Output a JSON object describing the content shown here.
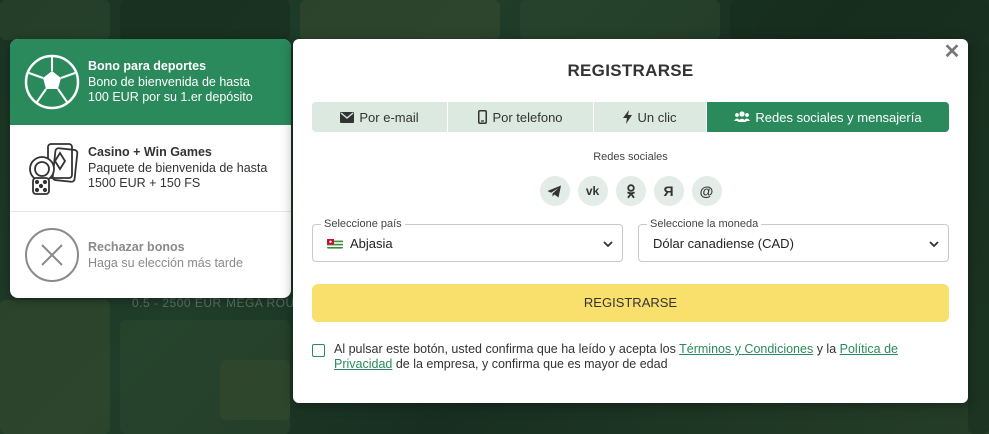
{
  "background": {
    "lobby_texts": [
      "0.5 - 2500 EUR",
      "MEGA ROULE"
    ]
  },
  "bonus_panel": {
    "sports": {
      "title": "Bono para deportes",
      "line1": "Bono de bienvenida de hasta",
      "line2": "100 EUR por su 1.er depósito",
      "icon": "soccer-ball-icon"
    },
    "casino": {
      "title": "Casino + Win Games",
      "line1": "Paquete de bienvenida de hasta",
      "line2": "1500 EUR + 150 FS",
      "icon": "casino-chips-cards-icon"
    },
    "reject": {
      "title": "Rechazar bonos",
      "line1": "Haga su elección más tarde",
      "icon": "close-circle-icon"
    }
  },
  "modal": {
    "close_glyph": "✕",
    "title": "REGISTRARSE",
    "tabs": [
      {
        "label": "Por e-mail",
        "icon": "envelope-icon"
      },
      {
        "label": "Por telefono",
        "icon": "phone-icon"
      },
      {
        "label": "Un clic",
        "icon": "lightning-icon"
      },
      {
        "label": "Redes sociales y mensajería",
        "icon": "users-icon",
        "active": true
      }
    ],
    "social_label": "Redes sociales",
    "social": [
      {
        "name": "telegram",
        "icon": "telegram-icon"
      },
      {
        "name": "vk",
        "glyph": "vk",
        "icon": "vk-icon"
      },
      {
        "name": "odnoklassniki",
        "icon": "odnoklassniki-icon"
      },
      {
        "name": "yandex",
        "glyph": "Я",
        "icon": "yandex-icon"
      },
      {
        "name": "mail",
        "glyph": "@",
        "icon": "mail-at-icon"
      }
    ],
    "country": {
      "label": "Seleccione país",
      "value": "Abjasia"
    },
    "currency": {
      "label": "Seleccione la moneda",
      "value": "Dólar canadiense (CAD)"
    },
    "submit_label": "REGISTRARSE",
    "consent": {
      "part1": "Al pulsar este botón, usted confirma que ha leído y acepta los ",
      "terms_link": "Términos y Condiciones",
      "part2": " y la ",
      "privacy_link": "Política de Privacidad",
      "part3": " de la empresa, y confirma que es mayor de edad"
    }
  },
  "colors": {
    "accent_green": "#2a8a5c",
    "button_yellow": "#f9df6c",
    "tab_bg": "#dbe9e1"
  }
}
